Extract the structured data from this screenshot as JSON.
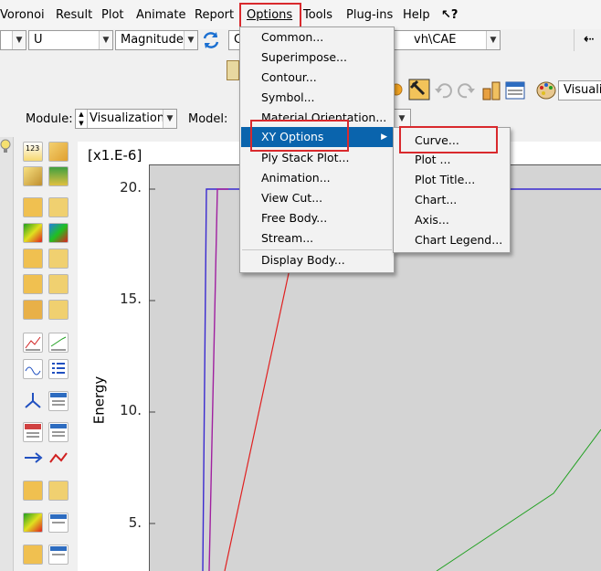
{
  "menubar": {
    "items": [
      "Voronoi",
      "Result",
      "Plot",
      "Animate",
      "Report",
      "Options",
      "Tools",
      "Plug-ins",
      "Help",
      "↖?"
    ]
  },
  "toolbar1": {
    "combo1_value": "",
    "combo2_value": "U",
    "combo3_value": "Magnitude",
    "path_value": "vh\\CAE",
    "combo_c_prefix": "C"
  },
  "toolbar2": {
    "visualiz_value": "Visualiz"
  },
  "context": {
    "module_label": "Module:",
    "module_value": "Visualization",
    "model_label": "Model:"
  },
  "options_menu": {
    "items": [
      "Common...",
      "Superimpose...",
      "Contour...",
      "Symbol...",
      "Material Orientation...",
      "XY Options",
      "Ply Stack Plot...",
      "Animation...",
      "View Cut...",
      "Free Body...",
      "Stream...",
      "Display Body..."
    ]
  },
  "xy_submenu": {
    "items": [
      "Curve...",
      "Plot ...",
      "Plot Title...",
      "Chart...",
      "Axis...",
      "Chart Legend..."
    ]
  },
  "chart_data": {
    "type": "line",
    "ylabel": "Energy",
    "y_multiplier_label": "[x1.E-6]",
    "y_ticks": [
      "20.",
      "15.",
      "10.",
      "5."
    ],
    "series": [
      {
        "color": "#3a2ad0"
      },
      {
        "color": "#a020a0"
      },
      {
        "color": "#e02020"
      },
      {
        "color": "#20a020"
      }
    ]
  },
  "colors": {
    "highlight": "#0a64ad",
    "annotation": "#d9292d",
    "plot_bg": "#d4d4d4"
  }
}
